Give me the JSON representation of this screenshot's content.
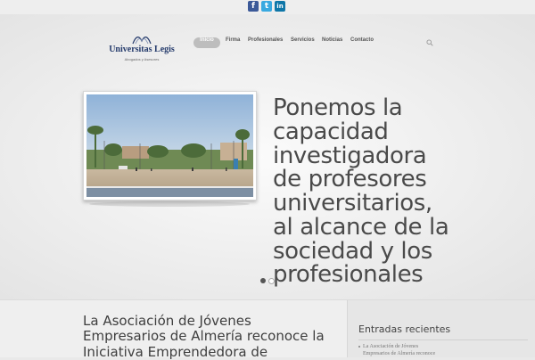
{
  "social": {
    "facebook_glyph": "f",
    "twitter_glyph": "t",
    "linkedin_glyph": "in"
  },
  "logo": {
    "title": "Universitas Legis",
    "tagline": "Abogados y Asesores",
    "color": "#243a6b"
  },
  "nav": {
    "items": [
      {
        "label": "Inicio",
        "active": true
      },
      {
        "label": "Firma"
      },
      {
        "label": "Profesionales"
      },
      {
        "label": "Servicios"
      },
      {
        "label": "Noticias"
      },
      {
        "label": "Contacto"
      }
    ]
  },
  "slider": {
    "text": "Ponemos la\ncapacidad\ninvestigadora\nde profesores\nuniversitarios,\nal alcance de la\nsociedad y los\nprofesionales",
    "active_dot": 0,
    "dot_count": 2
  },
  "main": {
    "post_title": "La Asociación de Jóvenes\nEmpresarios de Almería reconoce la\nIniciativa Emprendedora de"
  },
  "sidebar": {
    "title": "Entradas recientes",
    "recent_posts": [
      {
        "line1": "La Asociación de Jóvenes",
        "line2": "Empresarios de Almería reconoce"
      }
    ]
  }
}
